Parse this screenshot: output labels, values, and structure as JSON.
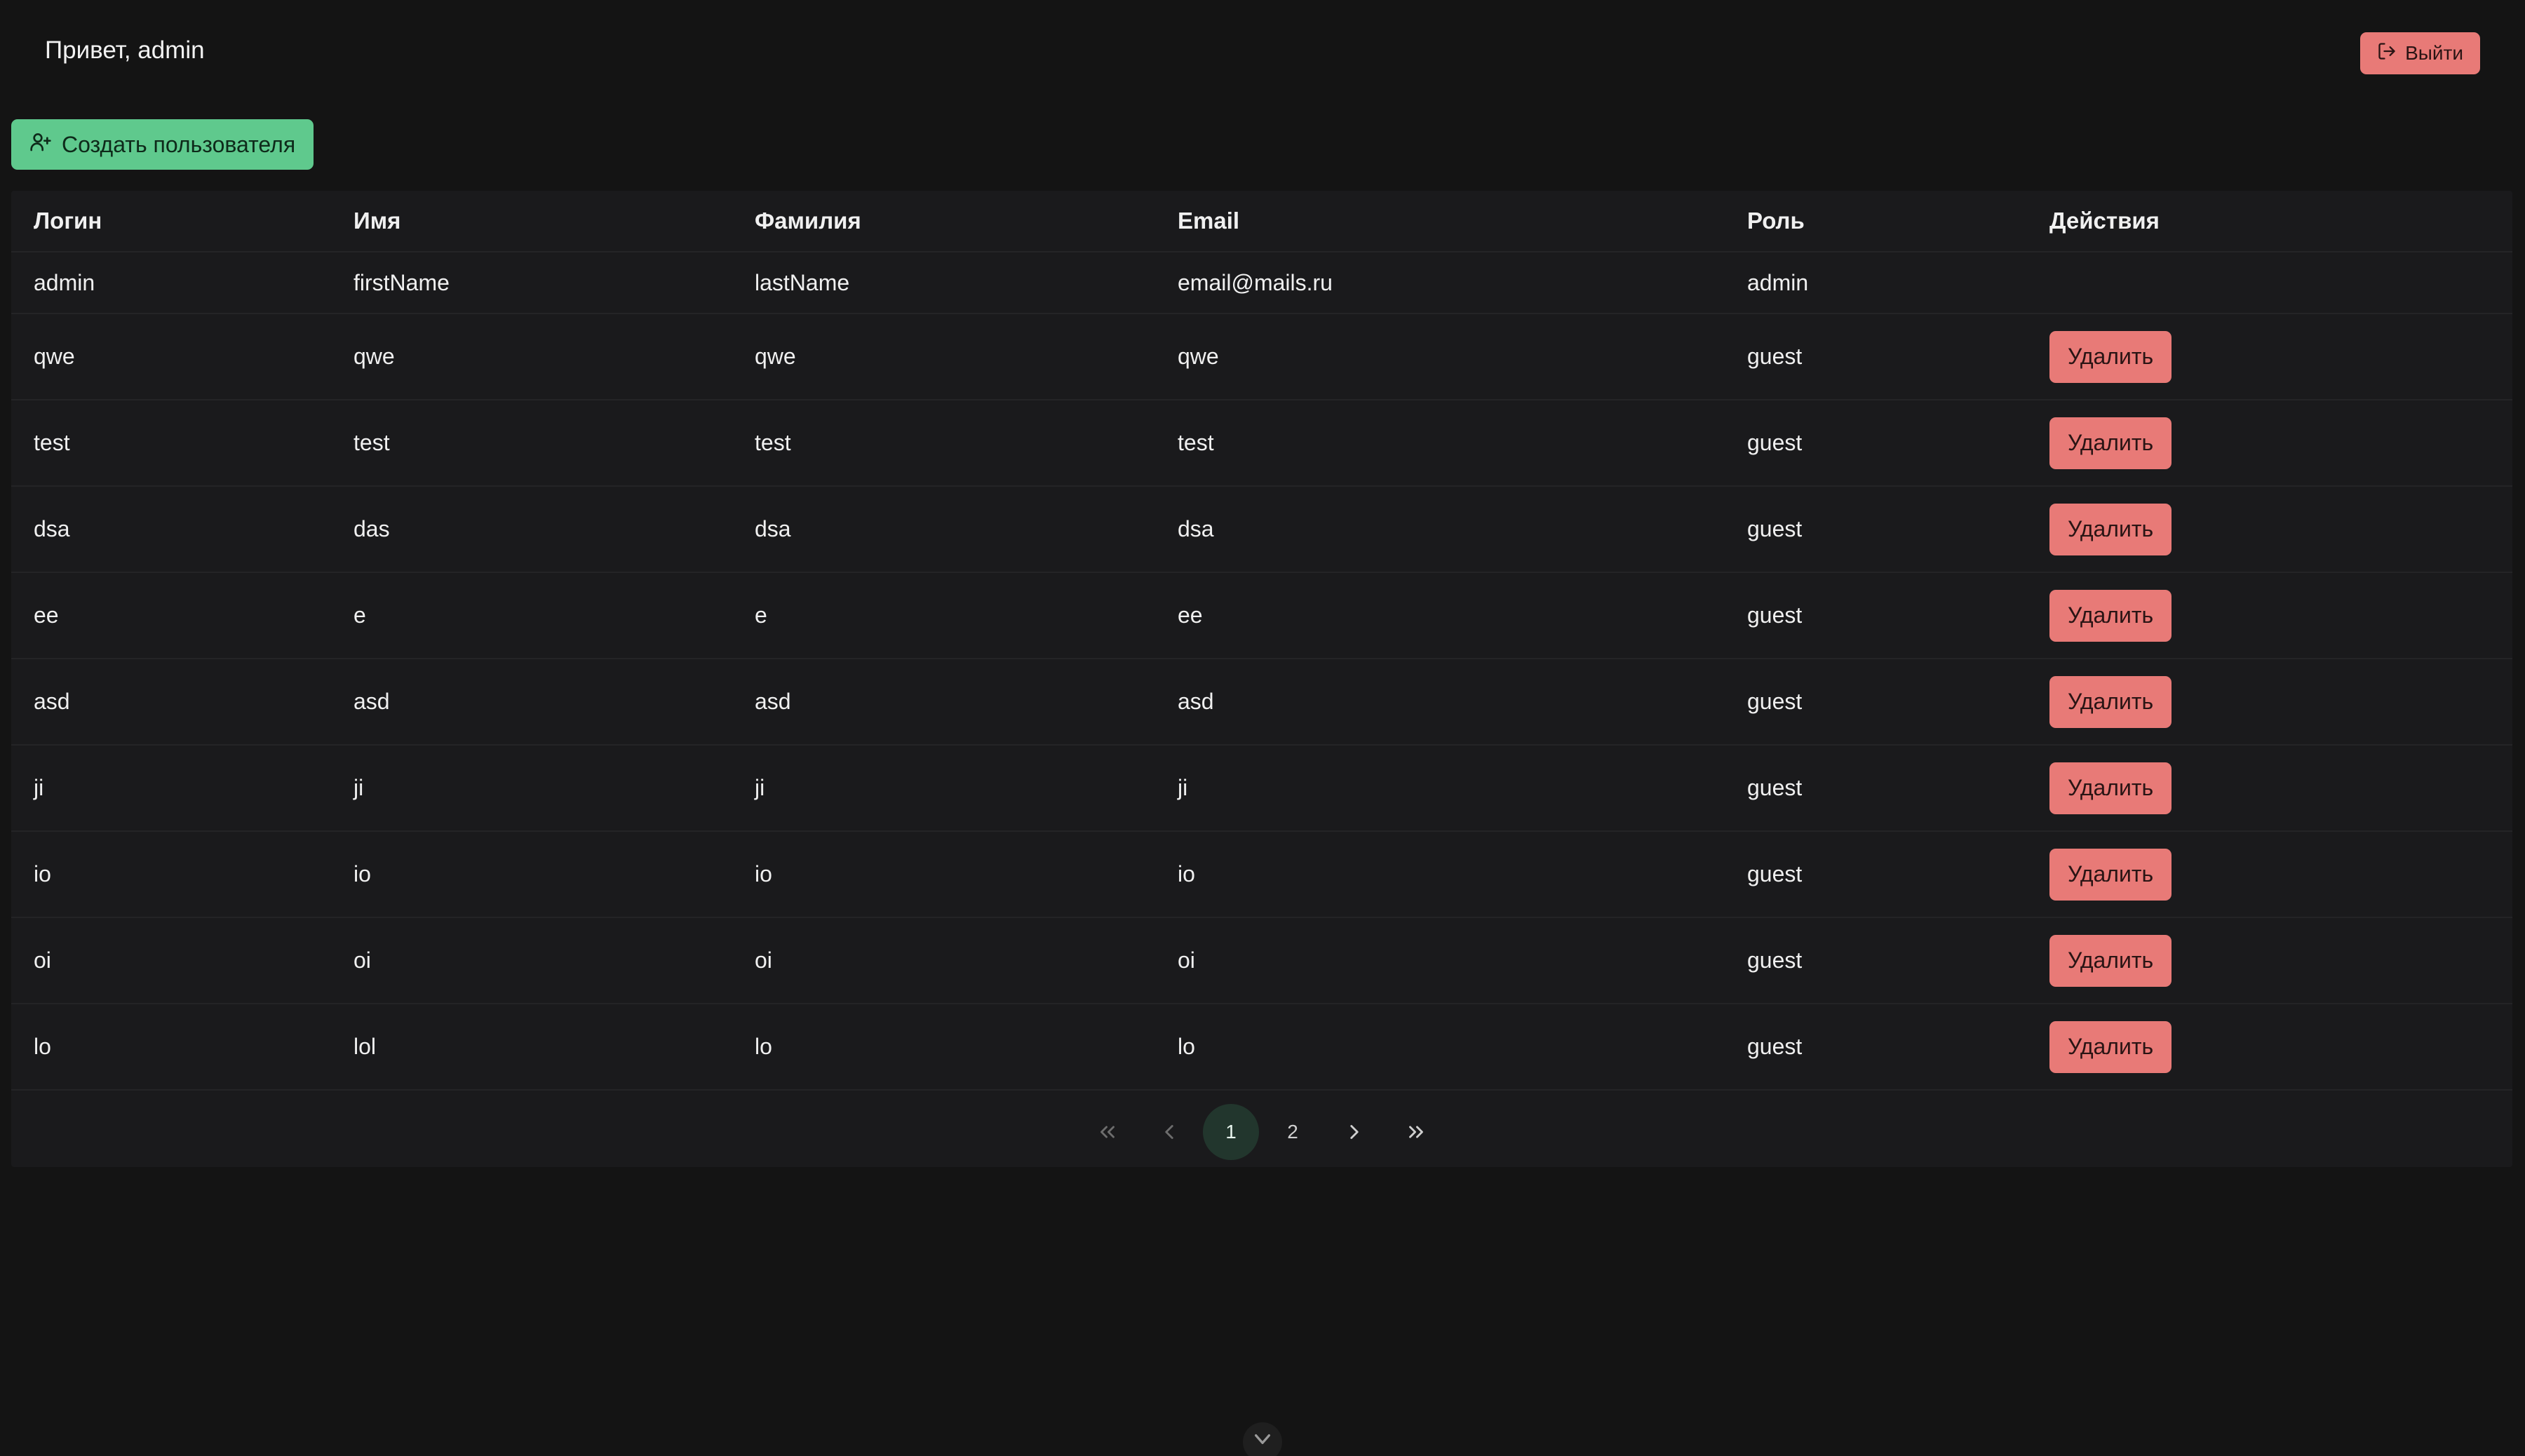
{
  "header": {
    "greeting": "Привет, admin",
    "logout_label": "Выйти"
  },
  "toolbar": {
    "create_user_label": "Создать пользователя"
  },
  "table": {
    "columns": [
      "Логин",
      "Имя",
      "Фамилия",
      "Email",
      "Роль",
      "Действия"
    ],
    "delete_label": "Удалить",
    "rows": [
      {
        "login": "admin",
        "first": "firstName",
        "last": "lastName",
        "email": "email@mails.ru",
        "role": "admin"
      },
      {
        "login": "qwe",
        "first": "qwe",
        "last": "qwe",
        "email": "qwe",
        "role": "guest"
      },
      {
        "login": "test",
        "first": "test",
        "last": "test",
        "email": "test",
        "role": "guest"
      },
      {
        "login": "dsa",
        "first": "das",
        "last": "dsa",
        "email": "dsa",
        "role": "guest"
      },
      {
        "login": "ee",
        "first": "e",
        "last": "e",
        "email": "ee",
        "role": "guest"
      },
      {
        "login": "asd",
        "first": "asd",
        "last": "asd",
        "email": "asd",
        "role": "guest"
      },
      {
        "login": "ji",
        "first": "ji",
        "last": "ji",
        "email": "ji",
        "role": "guest"
      },
      {
        "login": "io",
        "first": "io",
        "last": "io",
        "email": "io",
        "role": "guest"
      },
      {
        "login": "oi",
        "first": "oi",
        "last": "oi",
        "email": "oi",
        "role": "guest"
      },
      {
        "login": "lo",
        "first": "lol",
        "last": "lo",
        "email": "lo",
        "role": "guest"
      }
    ]
  },
  "pagination": {
    "pages": [
      "1",
      "2"
    ],
    "current": "1"
  },
  "colors": {
    "background": "#141414",
    "table_background": "#1a1a1c",
    "primary_green": "#5fc98d",
    "danger_red": "#e87a77",
    "active_page": "#22362d"
  },
  "icons": {
    "logout": "logout-icon",
    "create_user": "user-plus-icon",
    "first_page": "chevrons-left-icon",
    "prev_page": "chevron-left-icon",
    "next_page": "chevron-right-icon",
    "last_page": "chevrons-right-icon",
    "scroll": "chevron-down-icon"
  }
}
